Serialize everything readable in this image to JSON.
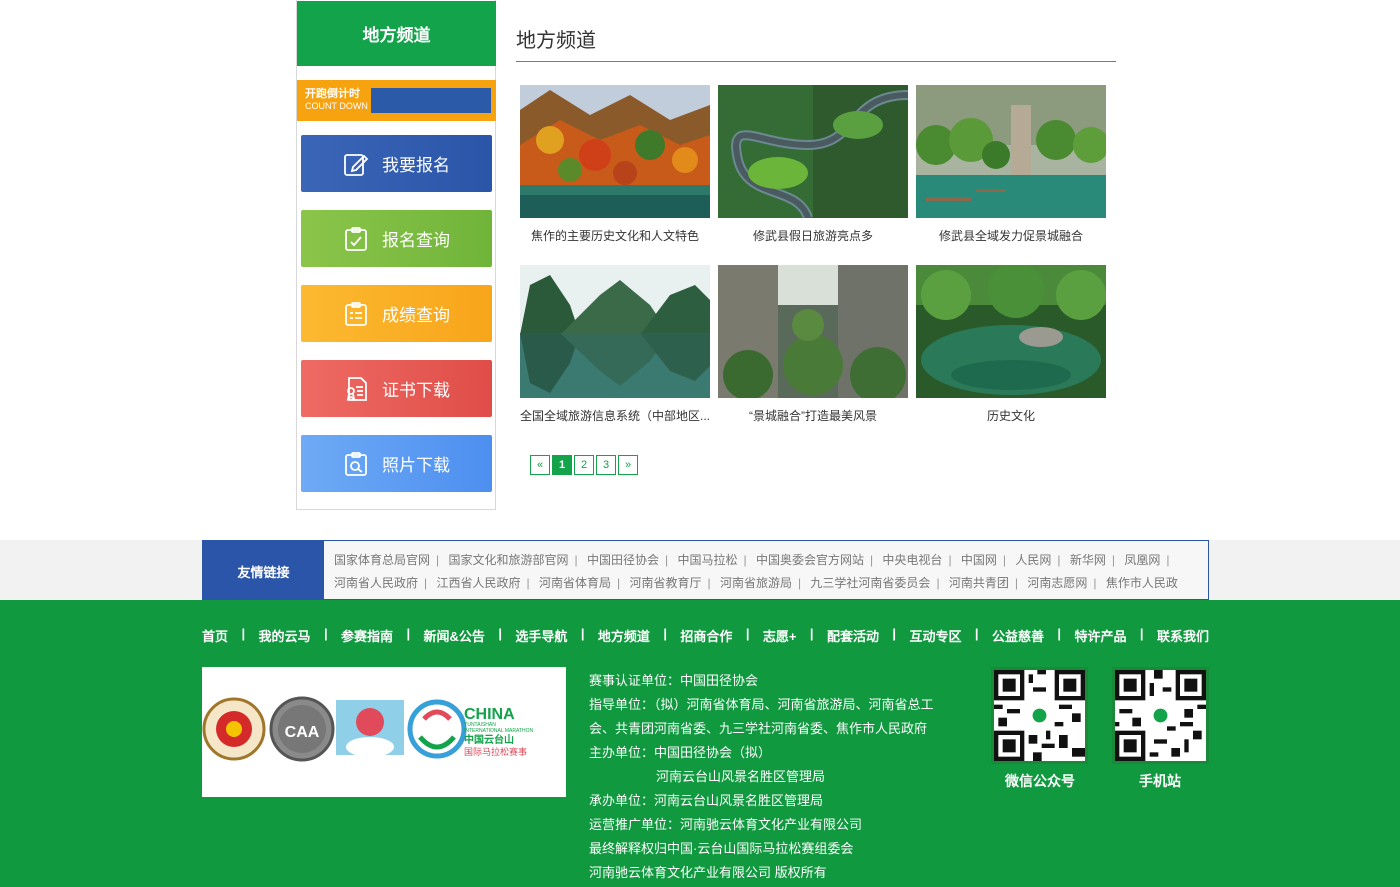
{
  "sidebar": {
    "title": "地方频道",
    "countdown": {
      "cn": "开跑倒计时",
      "en": "COUNT DOWN"
    },
    "buttons": [
      {
        "label": "我要报名",
        "icon": "edit-icon"
      },
      {
        "label": "报名查询",
        "icon": "clipboard-check-icon"
      },
      {
        "label": "成绩查询",
        "icon": "list-icon"
      },
      {
        "label": "证书下载",
        "icon": "certificate-icon"
      },
      {
        "label": "照片下载",
        "icon": "photo-search-icon"
      }
    ]
  },
  "main": {
    "title": "地方频道",
    "cards": [
      {
        "caption": "焦作的主要历史文化和人文特色"
      },
      {
        "caption": "修武县假日旅游亮点多"
      },
      {
        "caption": "修武县全域发力促景城融合"
      },
      {
        "caption": "全国全域旅游信息系统（中部地区..."
      },
      {
        "caption": "“景城融合”打造最美风景"
      },
      {
        "caption": "历史文化"
      }
    ],
    "pagination": {
      "prev": "«",
      "pages": [
        "1",
        "2",
        "3"
      ],
      "current": "1",
      "next": "»"
    }
  },
  "links": {
    "label": "友情链接",
    "items": [
      "国家体育总局官网",
      "国家文化和旅游部官网",
      "中国田径协会",
      "中国马拉松",
      "中国奥委会官方网站",
      "中央电视台",
      "中国网",
      "人民网",
      "新华网",
      "凤凰网",
      "河南省人民政府",
      "江西省人民政府",
      "河南省体育局",
      "河南省教育厅",
      "河南省旅游局",
      "九三学社河南省委员会",
      "河南共青团",
      "河南志愿网",
      "焦作市人民政"
    ]
  },
  "footer": {
    "nav": [
      "首页",
      "|",
      "我的云马",
      "|",
      "参赛指南",
      "|",
      "新闻&公告",
      "|",
      "选手导航",
      "|",
      "地方频道",
      "|",
      "招商合作",
      "|",
      "志愿+",
      "|",
      "配套活动",
      "|",
      "互动专区",
      "|",
      "公益慈善",
      "|",
      "特许产品",
      "|",
      "联系我们"
    ],
    "logo_text": {
      "china": "CHINA",
      "sub1": "YUNTAISHAN",
      "sub2": "INTERNATIONAL MARATHON",
      "cn1": "中国云台山",
      "cn2": "国际马拉松赛事",
      "caa": "CAA"
    },
    "info": [
      "赛事认证单位：中国田径协会",
      "指导单位：（拟）河南省体育局、河南省旅游局、河南省总工会、共青团河南省委、九三学社河南省委、焦作市人民政府",
      "主办单位：中国田径协会（拟）",
      "河南云台山风景名胜区管理局",
      "承办单位：河南云台山风景名胜区管理局",
      "运营推广单位：河南驰云体育文化产业有限公司",
      "最终解释权归中国·云台山国际马拉松赛组委会",
      "河南驰云体育文化产业有限公司 版权所有"
    ],
    "qr": [
      {
        "label": "微信公众号"
      },
      {
        "label": "手机站"
      }
    ]
  }
}
